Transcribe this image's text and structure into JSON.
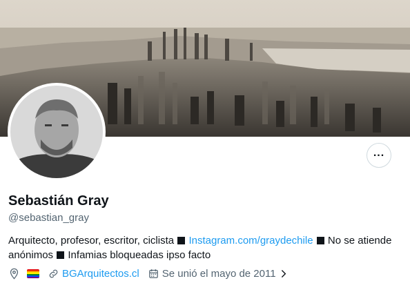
{
  "profile": {
    "display_name": "Sebastián Gray",
    "handle": "@sebastian_gray",
    "bio": {
      "part1": "Arquitecto, profesor, escritor, ciclista",
      "link": "Instagram.com/graydechile",
      "part2": "No se atiende anónimos",
      "part3": "Infamias bloqueadas ipso facto"
    },
    "meta": {
      "location_icon": "location-pin-icon",
      "flag": "rainbow-flag",
      "website": "BGArquitectos.cl",
      "joined": "Se unió el mayo de 2011"
    }
  },
  "colors": {
    "link": "#1d9bf0",
    "text": "#0f1419",
    "secondary": "#536471",
    "border": "#cfd9de"
  },
  "icons": {
    "more": "more-horizontal-icon",
    "website": "link-icon",
    "calendar": "calendar-icon",
    "chevron": "chevron-right-icon"
  }
}
